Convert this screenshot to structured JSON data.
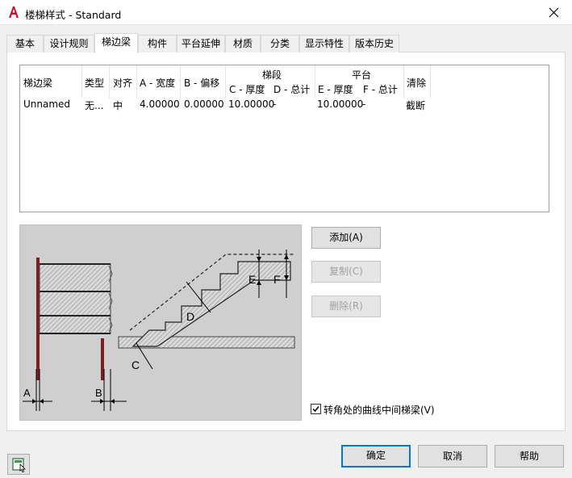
{
  "window": {
    "title": "楼梯样式 - Standard",
    "app_icon": "autocad-a-icon",
    "close_icon": "close-icon"
  },
  "tabs": [
    {
      "label": "基本"
    },
    {
      "label": "设计规则"
    },
    {
      "label": "梯边梁",
      "active": true
    },
    {
      "label": "构件"
    },
    {
      "label": "平台延伸"
    },
    {
      "label": "材质"
    },
    {
      "label": "分类"
    },
    {
      "label": "显示特性"
    },
    {
      "label": "版本历史"
    }
  ],
  "grid": {
    "headers": {
      "stringer": "梯边梁",
      "type": "类型",
      "align": "对齐",
      "width": "A - 宽度",
      "offset": "B - 偏移",
      "flight_group": "梯段",
      "flight_c": "C - 厚度",
      "flight_d": "D - 总计",
      "landing_group": "平台",
      "landing_e": "E - 厚度",
      "landing_f": "F - 总计",
      "cleanup": "清除"
    },
    "rows": [
      {
        "stringer": "Unnamed",
        "type": "无...",
        "align": "中",
        "width": "4.00000",
        "offset": "0.00000",
        "flight_c": "10.00000",
        "flight_d": "-",
        "landing_e": "10.00000",
        "landing_f": "-",
        "cleanup": "截断"
      }
    ]
  },
  "diagram": {
    "labels": {
      "a": "A",
      "b": "B",
      "c": "C",
      "d": "D",
      "e": "E",
      "f": "F"
    }
  },
  "side_buttons": {
    "add": "添加(A)",
    "copy": "复制(C)",
    "delete": "删除(R)"
  },
  "checkbox": {
    "label": "转角处的曲线中间梯梁(V)",
    "checked": true
  },
  "footer": {
    "ok": "确定",
    "cancel": "取消",
    "help": "帮助",
    "left_icon": "display-manager-icon"
  },
  "colors": {
    "accent": "#0078d7",
    "diagram_bg": "#cfcfcf",
    "app_icon_red": "#c8102e"
  }
}
